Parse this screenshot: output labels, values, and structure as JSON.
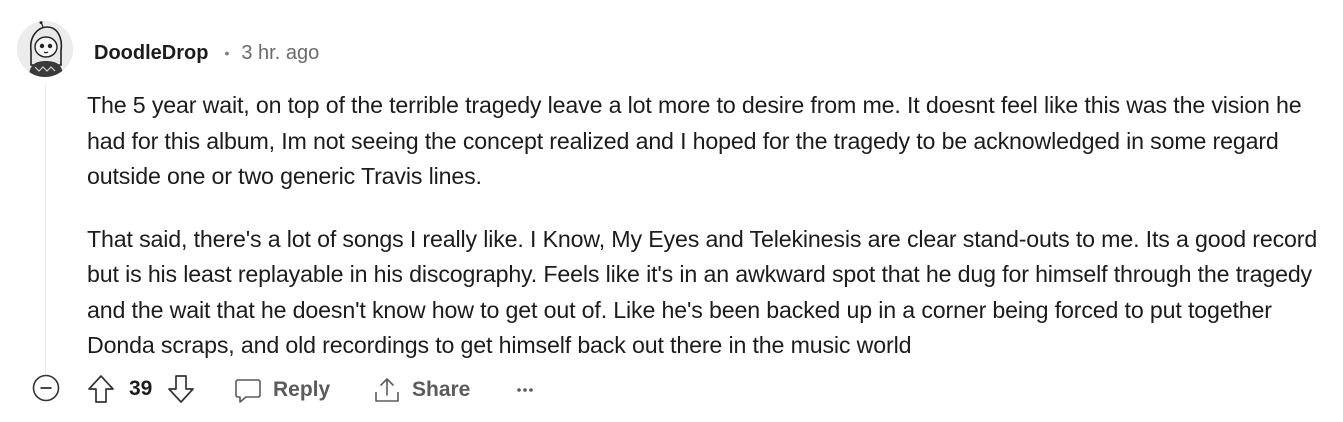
{
  "comment": {
    "author": "DoodleDrop",
    "separator": "•",
    "timestamp": "3 hr. ago",
    "paragraphs": [
      "The 5 year wait, on top of the terrible tragedy leave a lot more to desire from me. It doesnt feel like this was the vision he had for this album, Im not seeing the concept realized and I hoped for the tragedy to be acknowledged in some regard outside one or two generic Travis lines.",
      "That said, there's a lot of songs I really like. I Know, My Eyes and Telekinesis are clear stand-outs to me. Its a good record but is his least replayable in his discography. Feels like it's in an awkward spot that he dug for himself through the tragedy and the wait that he doesn't know how to get out of. Like he's been backed up in a corner being forced to put together Donda scraps, and old recordings to get himself back out there in the music world"
    ]
  },
  "actions": {
    "score": "39",
    "reply_label": "Reply",
    "share_label": "Share",
    "more_label": "···"
  },
  "icons": {
    "collapse": "minus-circle-icon",
    "upvote": "arrow-up-icon",
    "downvote": "arrow-down-icon",
    "reply": "speech-bubble-icon",
    "share": "share-upload-icon",
    "more": "ellipsis-icon"
  },
  "colors": {
    "text": "#1c1c1c",
    "meta": "#6a6a6a",
    "action": "#5b5b5b",
    "thread_line": "#e5ebee"
  }
}
